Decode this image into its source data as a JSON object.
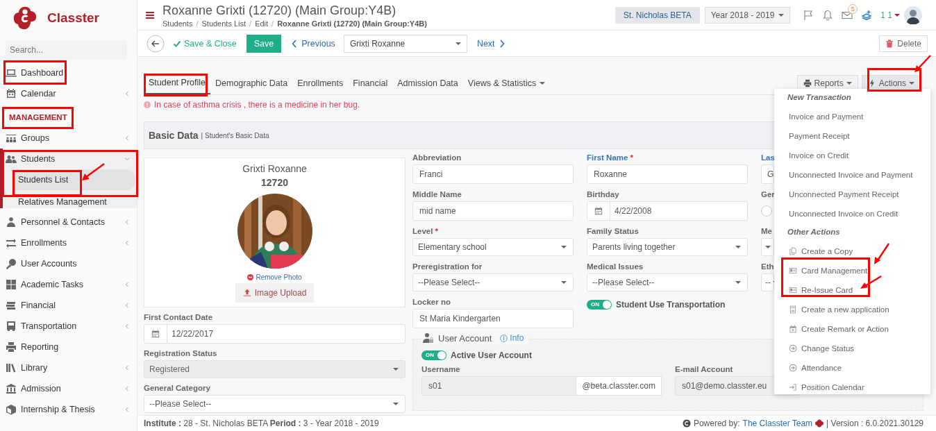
{
  "app": {
    "logo_text": "Classter"
  },
  "sidebar": {
    "search_placeholder": "Search...",
    "items": [
      {
        "kind": "item",
        "label": "Dashboard"
      },
      {
        "kind": "item",
        "label": "Calendar",
        "expanded": false
      },
      {
        "kind": "section",
        "label": "MANAGEMENT"
      },
      {
        "kind": "item",
        "label": "Groups",
        "expanded": false
      },
      {
        "kind": "item",
        "label": "Students",
        "expanded": true,
        "children": [
          {
            "label": "Students List",
            "selected": true
          },
          {
            "label": "Relatives Management",
            "selected": false
          }
        ]
      },
      {
        "kind": "item",
        "label": "Personnel & Contacts",
        "expanded": false
      },
      {
        "kind": "item",
        "label": "Enrollments",
        "expanded": false
      },
      {
        "kind": "item",
        "label": "User Accounts"
      },
      {
        "kind": "item",
        "label": "Academic Tasks",
        "expanded": false
      },
      {
        "kind": "item",
        "label": "Financial",
        "expanded": false
      },
      {
        "kind": "item",
        "label": "Transportation",
        "expanded": false
      },
      {
        "kind": "item",
        "label": "Reporting"
      },
      {
        "kind": "item",
        "label": "Library",
        "expanded": false
      },
      {
        "kind": "item",
        "label": "Admission",
        "expanded": false
      },
      {
        "kind": "item",
        "label": "Internship & Thesis",
        "expanded": false
      }
    ]
  },
  "header": {
    "title": "Roxanne Grixti (12720) (Main Group:Y4B)",
    "breadcrumb_separator": "/",
    "breadcrumb": [
      "Students",
      "Students List",
      "Edit",
      "Roxanne Grixti (12720) (Main Group:Y4B)"
    ],
    "institute": "St. Nicholas BETA",
    "year": "Year 2018 - 2019",
    "mail_count": "5",
    "user": "1 1"
  },
  "toolbar": {
    "save_close": "Save & Close",
    "save": "Save",
    "previous": "Previous",
    "student": "Grixti Roxanne",
    "next": "Next",
    "delete": "Delete"
  },
  "tabs": [
    {
      "label": "Student Profile",
      "selected": true
    },
    {
      "label": "Demographic Data",
      "selected": false
    },
    {
      "label": "Enrollments",
      "selected": false
    },
    {
      "label": "Financial",
      "selected": false
    },
    {
      "label": "Admission Data",
      "selected": false
    },
    {
      "label": "Views & Statistics",
      "selected": false,
      "has_menu": true
    }
  ],
  "reports": "Reports",
  "actions": {
    "label": "Actions",
    "open": true,
    "menu": [
      {
        "kind": "header",
        "label": "New Transaction"
      },
      {
        "kind": "item",
        "label": "Invoice and Payment"
      },
      {
        "kind": "item",
        "label": "Payment Receipt"
      },
      {
        "kind": "item",
        "label": "Invoice on Credit"
      },
      {
        "kind": "item",
        "label": "Unconnected Invoice and Payment"
      },
      {
        "kind": "item",
        "label": "Unconnected Payment Receipt"
      },
      {
        "kind": "item",
        "label": "Unconnected Invoice on Credit"
      },
      {
        "kind": "header",
        "label": "Other Actions"
      },
      {
        "kind": "icon-item",
        "label": "Create a Copy"
      },
      {
        "kind": "icon-item",
        "label": "Card Management"
      },
      {
        "kind": "icon-item",
        "label": "Re-Issue Card"
      },
      {
        "kind": "icon-item",
        "label": "Create a new application"
      },
      {
        "kind": "icon-item",
        "label": "Create Remark or Action"
      },
      {
        "kind": "icon-item",
        "label": "Change Status"
      },
      {
        "kind": "icon-item",
        "label": "Attendance"
      },
      {
        "kind": "icon-item",
        "label": "Position Calendar"
      }
    ]
  },
  "alert": "In case of asthma crisis , there is a medicine in her bug.",
  "panel": {
    "title": "Basic Data",
    "subtitle": "| Student's Basic Data"
  },
  "profile": {
    "name": "Grixti Roxanne",
    "id": "12720",
    "remove_photo": "Remove Photo",
    "upload": "Image Upload"
  },
  "left_fields": [
    {
      "kind": "date",
      "label": "First Contact Date",
      "value": "12/22/2017"
    },
    {
      "kind": "select",
      "label": "Registration Status",
      "value": "Registered",
      "disabled": true
    },
    {
      "kind": "select",
      "label": "General Category",
      "value": "--Please Select--",
      "disabled": false
    }
  ],
  "columns": [
    [
      {
        "kind": "text",
        "label": "Abbreviation",
        "value": "Franci"
      },
      {
        "kind": "text",
        "label": "Middle Name",
        "value": "mid name"
      },
      {
        "kind": "select",
        "label": "Level",
        "value": "Elementary school",
        "required": "*"
      },
      {
        "kind": "select",
        "label": "Preregistration for",
        "value": "--Please Select--"
      },
      {
        "kind": "text",
        "label": "Locker no",
        "value": "St Maria Kindergarten"
      }
    ],
    [
      {
        "kind": "text",
        "label": "First Name",
        "value": "Roxanne",
        "required": "*",
        "accent": true
      },
      {
        "kind": "date",
        "label": "Birthday",
        "value": "4/22/2008"
      },
      {
        "kind": "select",
        "label": "Family Status",
        "value": "Parents living together"
      },
      {
        "kind": "select",
        "label": "Medical Issues",
        "value": "--Please Select--"
      },
      {
        "kind": "toggle",
        "label": "Student Use Transportation",
        "on": true,
        "text": "ON"
      }
    ],
    [
      {
        "kind": "text",
        "label": "Las",
        "value": "G",
        "accent": true
      },
      {
        "kind": "radio",
        "label": "Ger",
        "checked": false
      },
      {
        "kind": "select",
        "label": "Me"
      },
      {
        "kind": "select",
        "label": "Eth",
        "value": "--"
      }
    ]
  ],
  "user_account": {
    "title": "User Account",
    "info": "Info",
    "active": {
      "label": "Active User Account",
      "on": true,
      "text": "ON"
    },
    "username_label": "Username",
    "username": "s01",
    "domain": "@beta.classter.com",
    "email_label": "E-mail Account",
    "email": "s01@demo.classter.eu"
  },
  "footer": {
    "text": "**Institute :** 28 - St. Nicholas BETA **Period :** 3 - Year 2018 - 2019",
    "powered": "Powered by:",
    "team": "The Classter Team",
    "version": "| Version : 6.0.2021.30129"
  }
}
